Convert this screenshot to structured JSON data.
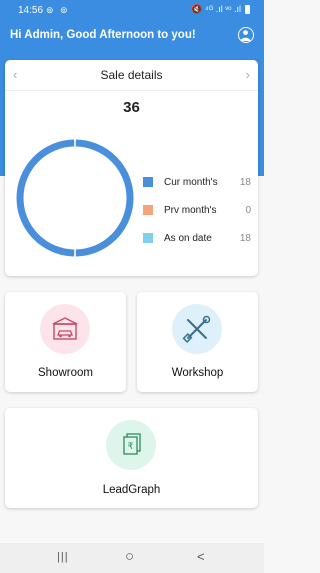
{
  "status_bar": {
    "time": "14:56",
    "left_icons": "⊚ ⊚",
    "right_icons": "🔇 ⁴ᴳ .ıl ᵛᵒ .ıl"
  },
  "header": {
    "greeting": "Hi Admin, Good Afternoon to you!",
    "profile_icon": "user-icon"
  },
  "sale_details": {
    "title": "Sale details",
    "total": "36",
    "prev_icon": "chevron-left-icon",
    "next_icon": "chevron-right-icon",
    "legend": [
      {
        "label": "Cur month's",
        "value": "18",
        "color": "#4a8fdc"
      },
      {
        "label": "Prv month's",
        "value": "0",
        "color": "#f4a37a"
      },
      {
        "label": "As on date",
        "value": "18",
        "color": "#7fd0ea"
      }
    ]
  },
  "chart_data": {
    "type": "pie",
    "categories": [
      "Cur month's",
      "Prv month's",
      "As on date"
    ],
    "values": [
      18,
      0,
      18
    ],
    "title": "Sale details",
    "colors": [
      "#4a8fdc",
      "#f4a37a",
      "#4a8fdc"
    ]
  },
  "tiles": {
    "showroom": {
      "label": "Showroom",
      "icon": "car-showroom-icon",
      "circle_color": "#fde4ea"
    },
    "workshop": {
      "label": "Workshop",
      "icon": "tools-icon",
      "circle_color": "#def1fa"
    },
    "leadgraph": {
      "label": "LeadGraph",
      "icon": "rupee-documents-icon",
      "circle_color": "#ddf5ea"
    }
  },
  "nav": {
    "recent": "|||",
    "home": "○",
    "back": "<"
  }
}
